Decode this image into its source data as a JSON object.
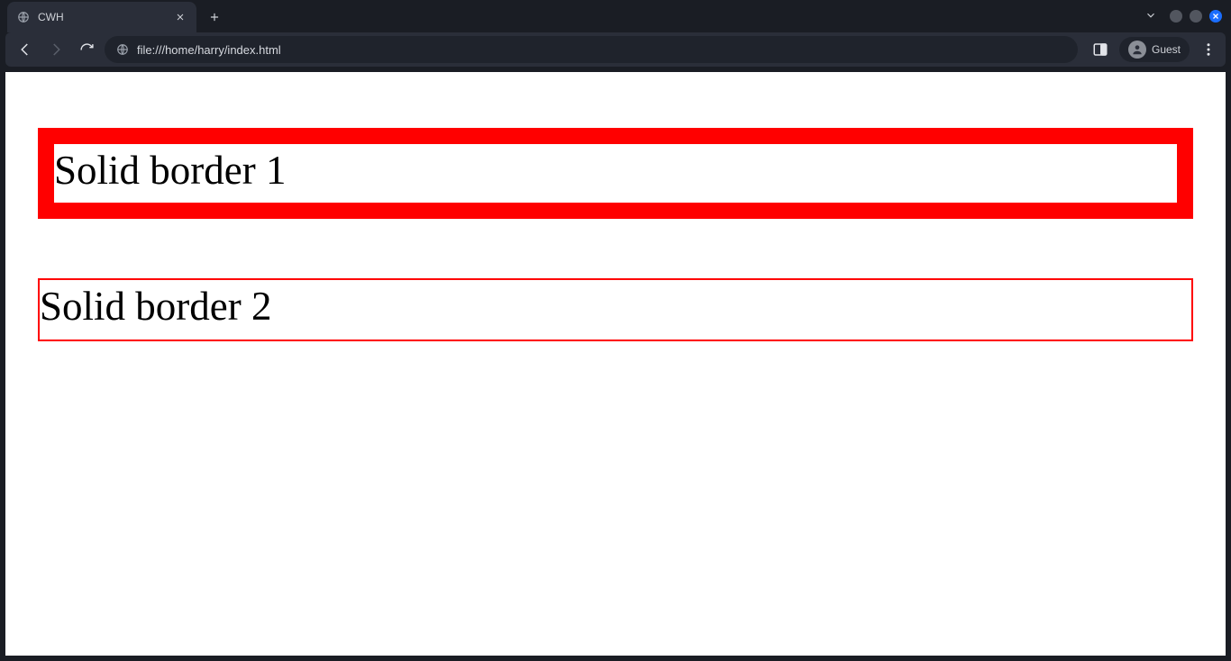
{
  "tab": {
    "title": "CWH"
  },
  "address": {
    "url": "file:///home/harry/index.html"
  },
  "profile": {
    "label": "Guest"
  },
  "page": {
    "heading1": "Solid border 1",
    "heading2": "Solid border 2"
  }
}
